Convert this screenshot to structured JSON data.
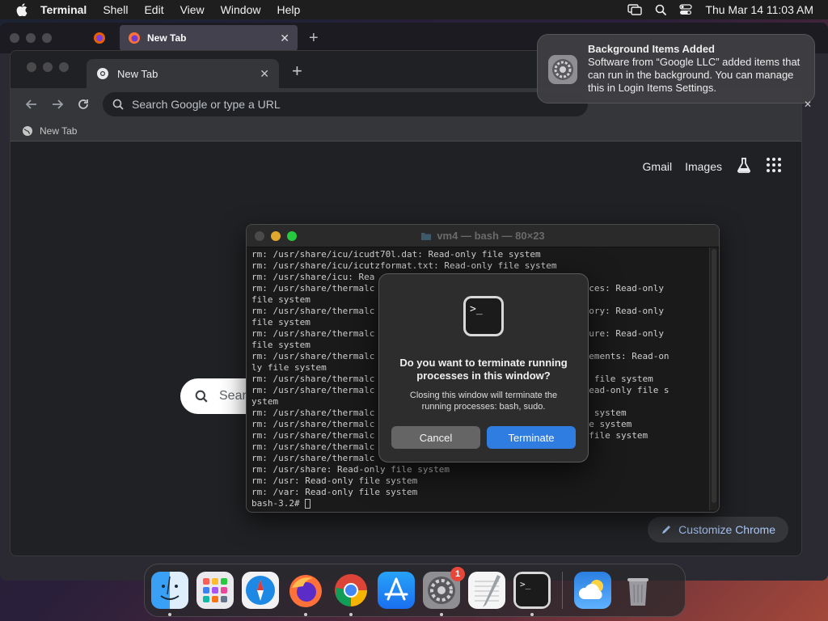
{
  "menubar": {
    "app": "Terminal",
    "items": [
      "Shell",
      "Edit",
      "View",
      "Window",
      "Help"
    ],
    "datetime": "Thu Mar 14  11:03 AM"
  },
  "firefox": {
    "tab_title": "New Tab"
  },
  "chrome": {
    "tab_title": "New Tab",
    "omnibox_placeholder": "Search Google or type a URL",
    "bookmark_label": "New Tab",
    "links": {
      "gmail": "Gmail",
      "images": "Images"
    },
    "search_pill_text": "Sear",
    "customize_label": "Customize Chrome"
  },
  "notification": {
    "title": "Background Items Added",
    "body": "Software from “Google LLC” added items that can run in the background. You can manage this in Login Items Settings."
  },
  "terminal": {
    "title": "vm4 — bash — 80×23",
    "lines": [
      "rm: /usr/share/icu/icudt70l.dat: Read-only file system",
      "rm: /usr/share/icu/icutzformat.txt: Read-only file system",
      "rm: /usr/share/icu: Rea",
      "rm: /usr/share/thermalc                                   esources: Read-only",
      "file system",
      "rm: /usr/share/thermalc                                   irectory: Read-only",
      "file system",
      "rm: /usr/share/thermalc                                   ignature: Read-only",
      "file system",
      "rm: /usr/share/thermalc                                   equirements: Read-on",
      "ly file system",
      "rm: /usr/share/thermalc                                   -only file system",
      "rm: /usr/share/thermalc                                   st: Read-only file s",
      "ystem",
      "rm: /usr/share/thermalc                                    file system",
      "rm: /usr/share/thermalc                                   y file system",
      "rm: /usr/share/thermalc                                   only file system",
      "rm: /usr/share/thermalc                                   em",
      "rm: /usr/share/thermalc",
      "rm: /usr/share: Read-only file system",
      "rm: /usr: Read-only file system",
      "rm: /var: Read-only file system"
    ],
    "prompt": "bash-3.2# "
  },
  "dialog": {
    "title": "Do you want to terminate running processes in this window?",
    "message": "Closing this window will terminate the running processes: bash, sudo.",
    "cancel_label": "Cancel",
    "confirm_label": "Terminate"
  },
  "dock": {
    "items": [
      "finder-icon",
      "launchpad-icon",
      "safari-icon",
      "firefox-icon",
      "chrome-icon",
      "app-store-icon",
      "system-settings-icon",
      "textedit-icon",
      "terminal-icon",
      "weather-icon",
      "trash-icon"
    ],
    "settings_badge": "1"
  },
  "colors": {
    "accent_blue": "#2f7de1",
    "chrome_bg": "#202124",
    "terminal_bg": "#1a1a1a"
  }
}
